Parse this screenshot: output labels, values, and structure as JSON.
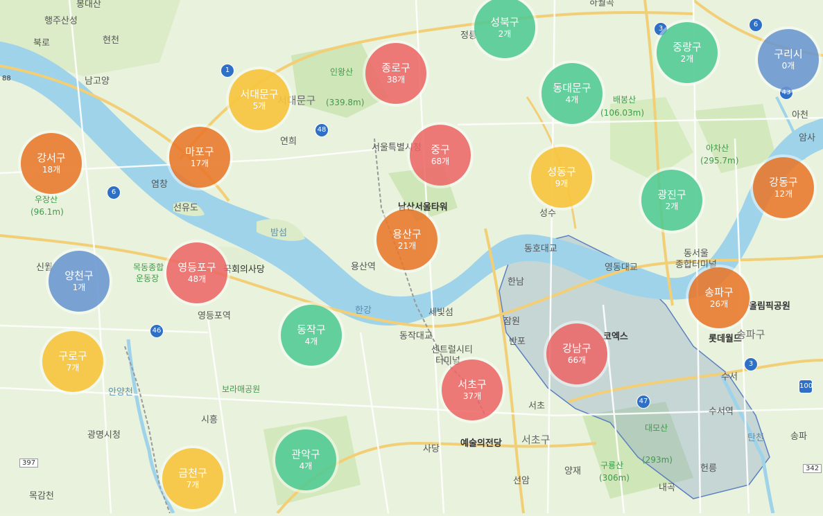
{
  "map": {
    "clusters": [
      {
        "name": "성북구",
        "count": "2개",
        "color": "green"
      },
      {
        "name": "종로구",
        "count": "38개",
        "color": "red"
      },
      {
        "name": "중랑구",
        "count": "2개",
        "color": "green"
      },
      {
        "name": "구리시",
        "count": "0개",
        "color": "blue"
      },
      {
        "name": "서대문구",
        "count": "5개",
        "color": "yellow"
      },
      {
        "name": "동대문구",
        "count": "4개",
        "color": "green"
      },
      {
        "name": "강서구",
        "count": "18개",
        "color": "orange"
      },
      {
        "name": "마포구",
        "count": "17개",
        "color": "orange"
      },
      {
        "name": "중구",
        "count": "68개",
        "color": "red"
      },
      {
        "name": "성동구",
        "count": "9개",
        "color": "yellow"
      },
      {
        "name": "광진구",
        "count": "2개",
        "color": "green"
      },
      {
        "name": "강동구",
        "count": "12개",
        "color": "orange"
      },
      {
        "name": "용산구",
        "count": "21개",
        "color": "orange"
      },
      {
        "name": "양천구",
        "count": "1개",
        "color": "blue"
      },
      {
        "name": "영등포구",
        "count": "48개",
        "color": "red"
      },
      {
        "name": "송파구",
        "count": "26개",
        "color": "orange"
      },
      {
        "name": "동작구",
        "count": "4개",
        "color": "green"
      },
      {
        "name": "강남구",
        "count": "66개",
        "color": "red"
      },
      {
        "name": "구로구",
        "count": "7개",
        "color": "yellow"
      },
      {
        "name": "서초구",
        "count": "37개",
        "color": "red"
      },
      {
        "name": "관악구",
        "count": "4개",
        "color": "green"
      },
      {
        "name": "금천구",
        "count": "7개",
        "color": "yellow"
      }
    ],
    "labels": {
      "inwangsan": "인왕산",
      "inwangsan_h": "(339.8m)",
      "baebongsan": "배봉산",
      "baebongsan_h": "(106.03m)",
      "achasan": "아차산",
      "achasan_h": "(295.7m)",
      "ujangsan": "우장산",
      "ujangsan_h": "(96.1m)",
      "daemosan": "대모산",
      "daemosan_h": "(293m)",
      "guryongsan": "구룡산",
      "guryongsan_h": "(306m)",
      "namsan_tower": "남산서울타워",
      "seoul_cityhall": "서울특별시청",
      "yongsan_station": "용산역",
      "yeouido": "영등포역",
      "national_assembly": "국회의사당",
      "mokdong": "목동종합",
      "mokdong2": "운동장",
      "central_terminal": "센트럴시티",
      "central_terminal2": "터미널",
      "arts_center": "예술의전당",
      "olympic_park": "올림픽공원",
      "lotte_world": "롯데월드",
      "coex": "코엑스",
      "dong_seoul": "동서울",
      "dong_seoul2": "종합터미널",
      "suseo": "수서역",
      "gwangmyeong": "광명시청",
      "boramae": "보라매공원",
      "hangang": "한강",
      "bamseom": "밤섬",
      "seonyudo": "선유도",
      "sebitseom": "세빛섬",
      "anyangcheon": "안양천",
      "tancheon": "탄천",
      "mokgamcheon": "목감천",
      "songpa": "송파구",
      "seocho": "서초구",
      "seodaemun": "서대문구",
      "jongno": "종로구",
      "seongbuk": "성북구",
      "jeongneung": "정릉",
      "haengju": "행주산성",
      "bukno": "북로",
      "hyeonchon": "현천",
      "bongdaesan": "봉대산",
      "namgoyang": "남고양",
      "haewol": "하월곡",
      "yeonhui": "연희",
      "yeomchang": "염창",
      "sinwol": "신월",
      "siheung": "시흥",
      "sadang": "사당",
      "seonam": "선암",
      "yangjae": "양재",
      "naegok": "내곡",
      "heolleung": "헌릉",
      "seocho_ic": "서초",
      "banpo": "반포",
      "jamwon": "잠원",
      "hannam": "한남",
      "dongjak_jc": "동작대교",
      "dongho_jc": "동호대교",
      "yeongdong_jc": "영동대교",
      "seongsu_jc": "성수",
      "acheon": "아천",
      "amsa": "암사",
      "suseo_ic": "수서",
      "songpa_ic": "송파",
      "guri_hwy": "구리"
    },
    "routes": {
      "r1": "1",
      "r3a": "3",
      "r3b": "3",
      "r6a": "6",
      "r6b": "6",
      "r46": "46",
      "r47": "47",
      "r48": "48",
      "r100": "100",
      "r342": "342",
      "r397": "397",
      "r43": "43",
      "r88": "88"
    }
  }
}
